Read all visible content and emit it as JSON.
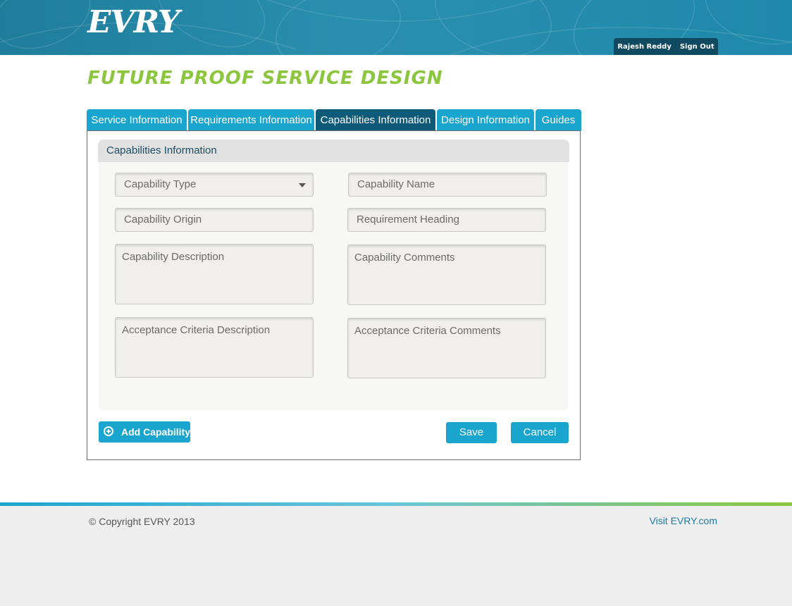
{
  "header": {
    "logo": "EVRY",
    "user_name": "Rajesh Reddy",
    "sign_out": "Sign Out"
  },
  "page_title": "Future Proof Service Design",
  "tabs": [
    {
      "label": "Service Information",
      "active": false
    },
    {
      "label": "Requirements Information",
      "active": false
    },
    {
      "label": "Capabilities Information",
      "active": true
    },
    {
      "label": "Design Information",
      "active": false
    },
    {
      "label": "Guides",
      "active": false
    }
  ],
  "section": {
    "title": "Capabilities Information",
    "fields": {
      "capability_type": "Capability Type",
      "capability_name": "Capability Name",
      "capability_origin": "Capability Origin",
      "requirement_heading": "Requirement Heading",
      "capability_description": "Capability Description",
      "capability_comments": "Capability Comments",
      "acceptance_criteria_description": "Acceptance Criteria Description",
      "acceptance_criteria_comments": "Acceptance Criteria Comments"
    }
  },
  "buttons": {
    "add_capability": "Add Capability",
    "save": "Save",
    "cancel": "Cancel"
  },
  "footer": {
    "copyright": "© Copyright EVRY 2013",
    "visit_link": "Visit EVRY.com"
  },
  "colors": {
    "brand_blue": "#1aa5cf",
    "active_tab": "#0d5b79",
    "title_green": "#8cc63f"
  }
}
